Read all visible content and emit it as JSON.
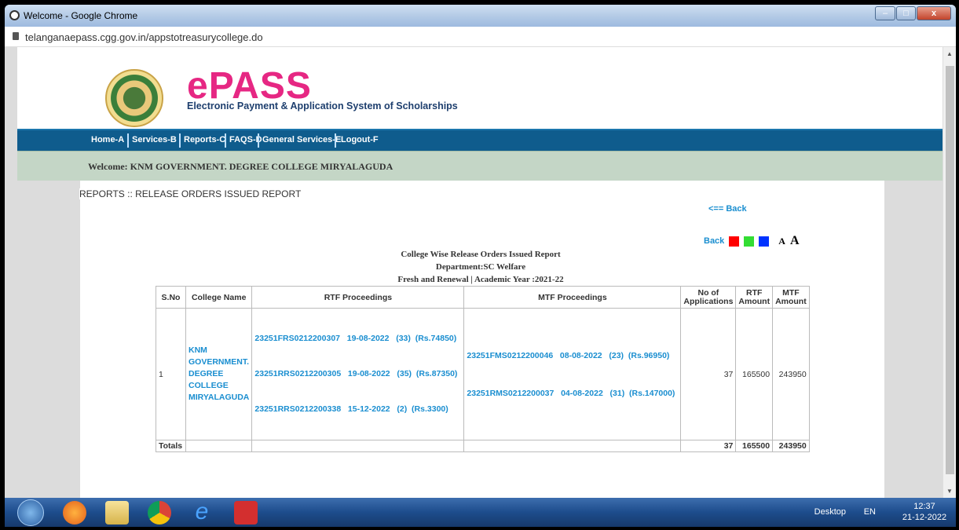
{
  "window": {
    "title": "Welcome - Google Chrome"
  },
  "address": {
    "url": "telanganaepass.cgg.gov.in/appstotreasurycollege.do"
  },
  "header": {
    "brand": "ePASS",
    "tagline": "Electronic Payment & Application System of Scholarships"
  },
  "nav": {
    "items": [
      "Home-A",
      "Services-B",
      "Reports-C",
      "FAQS-D",
      "General Services-E",
      "Logout-F"
    ]
  },
  "welcome": {
    "text": "Welcome: KNM GOVERNMENT. DEGREE COLLEGE MIRYALAGUDA"
  },
  "page": {
    "breadcrumb": "REPORTS :: RELEASE ORDERS ISSUED REPORT",
    "back_link": "<== Back",
    "back_label": "Back",
    "font_small": "A",
    "font_large": "A",
    "swatches": {
      "red": "#ff0000",
      "green": "#33dd33",
      "blue": "#0033ff"
    },
    "report_title": "College Wise Release Orders Issued Report",
    "department": "Department:SC Welfare",
    "year": "Fresh and Renewal | Academic Year :2021-22"
  },
  "table": {
    "headers": {
      "sno": "S.No",
      "college": "College Name",
      "rtf": "RTF Proceedings",
      "mtf": "MTF Proceedings",
      "apps": "No of Applications",
      "rtf_amt": "RTF Amount",
      "mtf_amt": "MTF Amount"
    },
    "row": {
      "sno": "1",
      "college": [
        "KNM",
        "GOVERNMENT.",
        "DEGREE",
        "COLLEGE",
        "MIRYALAGUDA"
      ],
      "rtf": [
        "23251FRS0212200307   19-08-2022   (33)  (Rs.74850)",
        "23251RRS0212200305   19-08-2022   (35)  (Rs.87350)",
        "23251RRS0212200338   15-12-2022   (2)  (Rs.3300)"
      ],
      "mtf": [
        "23251FMS0212200046   08-08-2022   (23)  (Rs.96950)",
        "23251RMS0212200037   04-08-2022   (31)  (Rs.147000)"
      ],
      "apps": "37",
      "rtf_amt": "165500",
      "mtf_amt": "243950"
    },
    "totals": {
      "label": "Totals",
      "apps": "37",
      "rtf_amt": "165500",
      "mtf_amt": "243950"
    }
  },
  "taskbar": {
    "desktop": "Desktop",
    "lang": "EN",
    "time": "12:37",
    "date": "21-12-2022"
  }
}
